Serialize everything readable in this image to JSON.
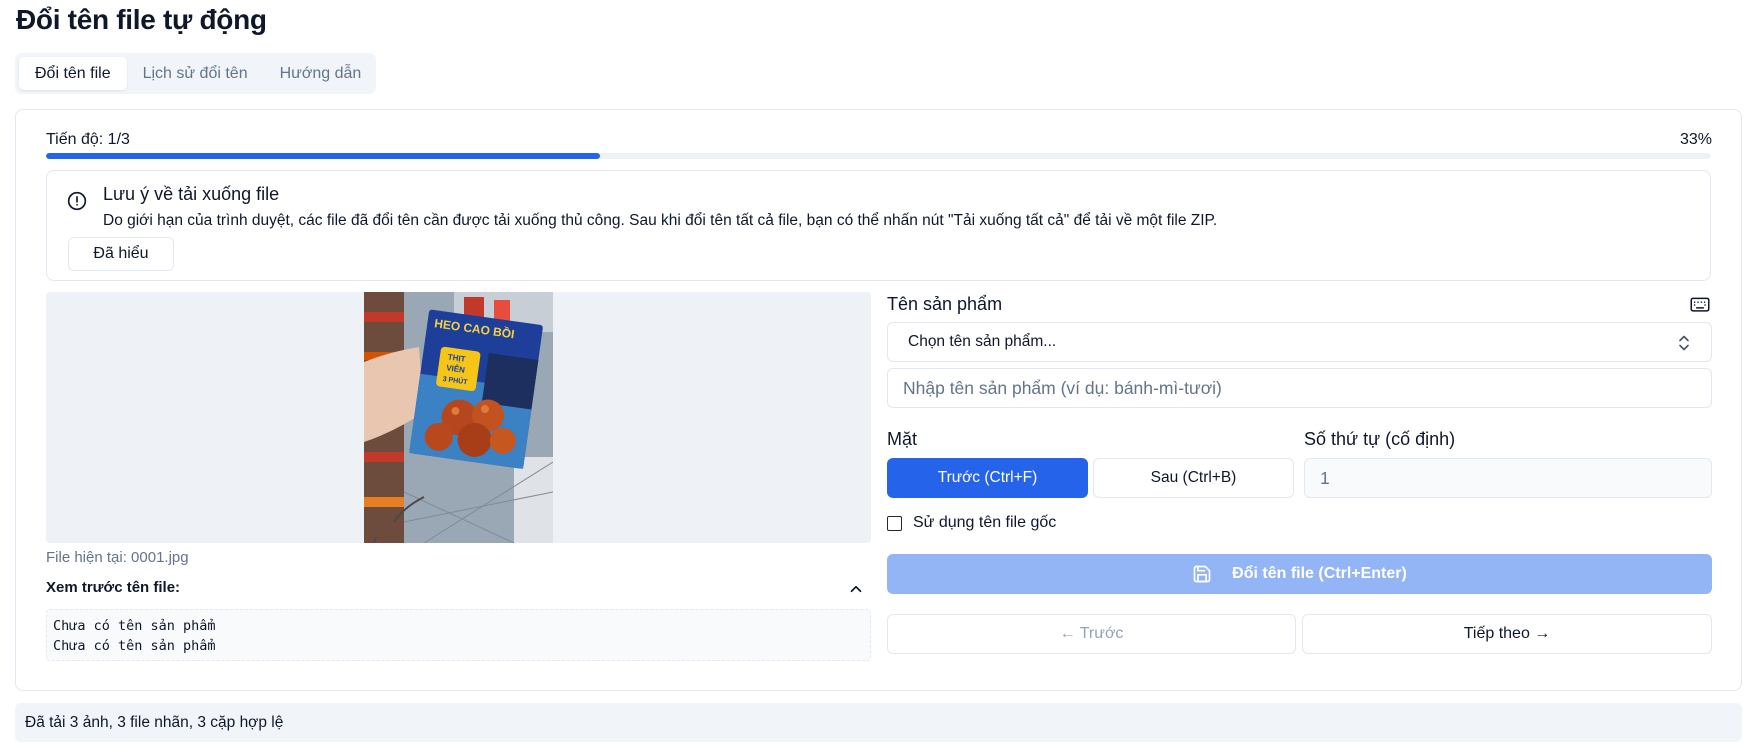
{
  "page": {
    "title": "Đổi tên file tự động"
  },
  "tabs": [
    {
      "label": "Đổi tên file",
      "active": true
    },
    {
      "label": "Lịch sử đổi tên",
      "active": false
    },
    {
      "label": "Hướng dẫn",
      "active": false
    }
  ],
  "progress": {
    "label": "Tiến độ: 1/3",
    "percent_text": "33%",
    "fraction": 0.333
  },
  "notice": {
    "title": "Lưu ý về tải xuống file",
    "description": "Do giới hạn của trình duyệt, các file đã đổi tên cần được tải xuống thủ công. Sau khi đổi tên tất cả file, bạn có thể nhấn nút \"Tải xuống tất cả\" để tải về một file ZIP.",
    "ack_label": "Đã hiểu",
    "icon": "alert-circle-icon"
  },
  "preview": {
    "current_file": "File hiện tại: 0001.jpg",
    "names_label": "Xem trước tên file:",
    "names": [
      "Chưa có tên sản phẩm",
      "Chưa có tên sản phẩm"
    ],
    "package_text": [
      "HEO CAO BỒI",
      "THỊT",
      "VIÊN",
      "3 PHÚT"
    ]
  },
  "form": {
    "product_label": "Tên sản phẩm",
    "product_select_value": "Chọn tên sản phẩm...",
    "product_input_placeholder": "Nhập tên sản phẩm (ví dụ: bánh-mì-tươi)",
    "face_label": "Mặt",
    "face_front": "Trước (Ctrl+F)",
    "face_back": "Sau (Ctrl+B)",
    "order_label": "Số thứ tự (cố định)",
    "order_value": "1",
    "use_original_label": "Sử dụng tên file gốc",
    "rename_button": "Đổi tên file (Ctrl+Enter)",
    "prev_button": "← Trước",
    "next_button": "Tiếp theo →"
  },
  "status": {
    "text": "Đã tải 3 ảnh, 3 file nhãn, 3 cặp hợp lệ"
  },
  "colors": {
    "primary": "#2563eb",
    "primary_disabled": "#93b4f5",
    "muted_bg": "#f1f5f9",
    "border": "#e2e8f0",
    "muted_text": "#64748b"
  }
}
